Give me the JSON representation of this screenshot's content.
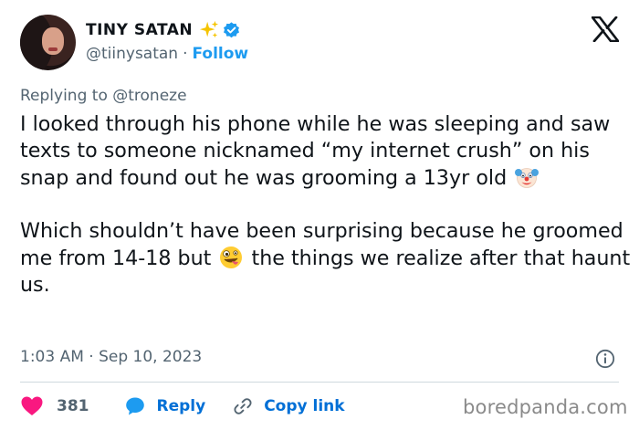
{
  "author": {
    "display_name": "TINY SATAN",
    "handle": "@tiinysatan",
    "separator": "·",
    "follow_label": "Follow"
  },
  "reply": {
    "prefix": "Replying to",
    "target": "@troneze"
  },
  "tweet": {
    "para1_part1": "I looked through his phone while he was sleeping and saw texts to someone nicknamed “my internet crush” on his snap and found out he was grooming a 13yr old",
    "para2_part1": "Which shouldn’t have been surprising because he groomed me from 14-18 but",
    "para2_part2": "the things we realize after that haunt us.",
    "emojis": [
      "clown-face-icon",
      "zany-face-icon"
    ]
  },
  "timestamp": "1:03 AM · Sep 10, 2023",
  "actions": {
    "likes": "381",
    "reply_label": "Reply",
    "copy_label": "Copy link"
  },
  "watermark": "boredpanda.com",
  "colors": {
    "link_blue": "#1d9bf0",
    "action_blue": "#006fd6",
    "heart_pink": "#f91880",
    "muted": "#536471"
  }
}
